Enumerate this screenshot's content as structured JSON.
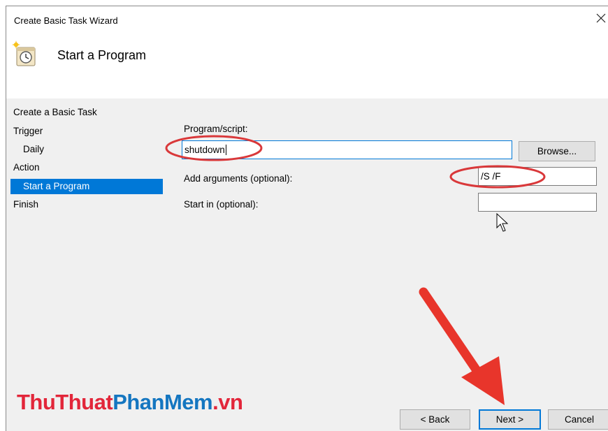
{
  "window": {
    "title": "Create Basic Task Wizard",
    "close_icon": "close-icon"
  },
  "header": {
    "heading": "Start a Program",
    "icon": "scheduled-task-clock-icon"
  },
  "sidebar": {
    "items": [
      {
        "label": "Create a Basic Task",
        "selected": false
      },
      {
        "label": "Trigger",
        "selected": false
      },
      {
        "label": "Daily",
        "selected": false
      },
      {
        "label": "Action",
        "selected": false
      },
      {
        "label": "Start a Program",
        "selected": true
      },
      {
        "label": "Finish",
        "selected": false
      }
    ],
    "selected_color": "#0078d7"
  },
  "form": {
    "program_label": "Program/script:",
    "program_value": "shutdown",
    "browse_label": "Browse...",
    "arguments_label": "Add arguments (optional):",
    "arguments_value": "/S /F",
    "start_in_label": "Start in (optional):",
    "start_in_value": ""
  },
  "footer": {
    "back_label": "< Back",
    "next_label": "Next >",
    "cancel_label": "Cancel"
  },
  "watermark": {
    "part1": "ThuThuat",
    "part2": "PhanMem",
    "part3": ".vn",
    "color_red": "#e2263a",
    "color_blue": "#1476c0"
  },
  "annotations": {
    "highlight_color": "#d9383a",
    "arrow_color": "#e8352b",
    "cursor_icon": "mouse-pointer-icon"
  }
}
